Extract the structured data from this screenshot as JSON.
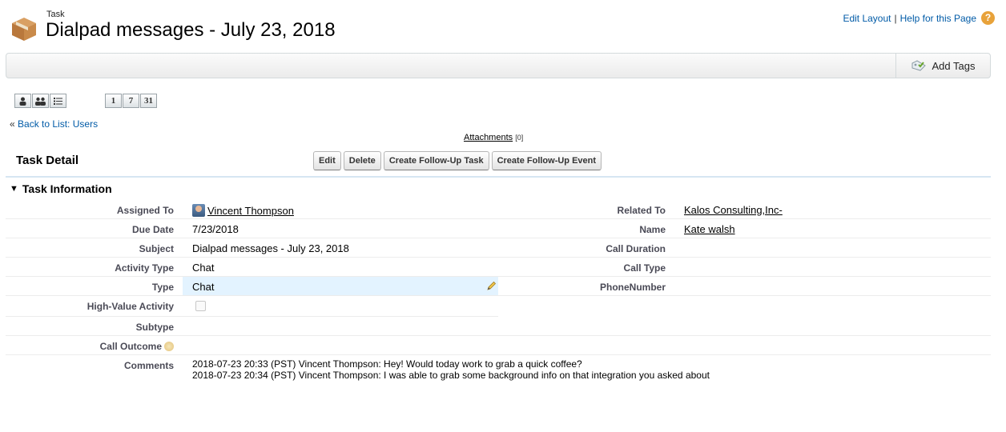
{
  "header": {
    "object_type": "Task",
    "title": "Dialpad messages - July 23, 2018",
    "links": {
      "edit_layout": "Edit Layout",
      "separator": "|",
      "help": "Help for this Page"
    },
    "help_icon_glyph": "?"
  },
  "tagbar": {
    "add_tags": "Add Tags"
  },
  "calendar_buttons": [
    "1",
    "7",
    "31"
  ],
  "back_link": {
    "arrows": "«",
    "label": "Back to List: Users"
  },
  "attachments": {
    "label": "Attachments",
    "count": "[0]"
  },
  "detail": {
    "title": "Task Detail",
    "buttons": {
      "edit": "Edit",
      "delete": "Delete",
      "follow_up_task": "Create Follow-Up Task",
      "follow_up_event": "Create Follow-Up Event"
    }
  },
  "section": {
    "toggle_glyph": "▼",
    "title": "Task Information"
  },
  "fields": {
    "assigned_to": {
      "label": "Assigned To",
      "value": "Vincent Thompson"
    },
    "due_date": {
      "label": "Due Date",
      "value": "7/23/2018"
    },
    "subject": {
      "label": "Subject",
      "value": "Dialpad messages - July 23, 2018"
    },
    "activity_type": {
      "label": "Activity Type",
      "value": "Chat"
    },
    "type": {
      "label": "Type",
      "value": "Chat"
    },
    "high_value": {
      "label": "High-Value Activity",
      "checked": false
    },
    "subtype": {
      "label": "Subtype",
      "value": ""
    },
    "call_outcome": {
      "label": "Call Outcome",
      "value": ""
    },
    "comments": {
      "label": "Comments",
      "line1": "2018-07-23 20:33 (PST) Vincent Thompson: Hey! Would today work to grab a quick coffee?",
      "line2": "2018-07-23 20:34 (PST) Vincent Thompson: I was able to grab some background info on that integration you asked about"
    },
    "related_to": {
      "label": "Related To",
      "value": "Kalos Consulting,Inc-"
    },
    "name": {
      "label": "Name",
      "value": "Kate walsh"
    },
    "call_duration": {
      "label": "Call Duration",
      "value": ""
    },
    "call_type": {
      "label": "Call Type",
      "value": ""
    },
    "phone_number": {
      "label": "PhoneNumber",
      "value": ""
    }
  },
  "colors": {
    "link": "#015ba7",
    "highlight": "#e3f3ff",
    "help_icon": "#e8a23a"
  }
}
